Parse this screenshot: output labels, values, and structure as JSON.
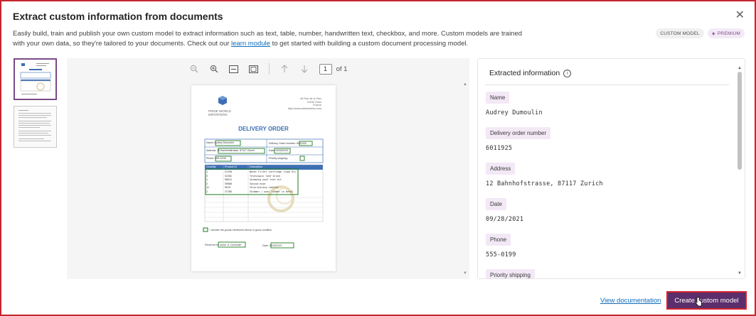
{
  "dialog": {
    "title": "Extract custom information from documents",
    "description_before": "Easily build, train and publish your own custom model to extract information such as text, table, number, handwritten text, checkbox, and more. Custom models are trained with your own data, so they're tailored to your documents. Check out our ",
    "link_text": "learn module",
    "description_after": " to get started with building a custom document processing model.",
    "close_icon": "close-icon"
  },
  "badges": {
    "custom_model": "CUSTOM MODEL",
    "premium": "PREMIUM"
  },
  "viewer": {
    "page_number": "1",
    "page_of": "of 1"
  },
  "document": {
    "company_line1": "PRIDE WORLD",
    "company_line2": "IMPORTERS",
    "address_line1": "46 Rue de la Paix",
    "address_line2": "10032 Paris",
    "address_line3": "France",
    "website": "http://www.webaddress.com",
    "title": "DELIVERY ORDER",
    "name_label": "Name:",
    "name_value": "Audrey Dumoulin",
    "order_label": "Delivery Order Number:",
    "order_value": "6011925",
    "address_label": "Address:",
    "address_value": "12 Bahnhofstrasse, 87117 Zurich",
    "date_label": "Date:",
    "date_value": "09/28/2021",
    "phone_label": "Phone:",
    "phone_value": "555-0199",
    "priority_label": "Priority shipping:",
    "col_quantity": "Quantity",
    "col_product": "Product ID",
    "col_description": "Description",
    "rows": [
      [
        "1",
        "51290",
        "Water Filter cartridge (type 01)"
      ],
      [
        "3",
        "52302",
        "Telescopic leaf brush"
      ],
      [
        "1",
        "90012",
        "Swimming pool test kit"
      ],
      [
        "2",
        "59000",
        "Vacuum hose"
      ],
      [
        "12",
        "9019",
        "Chlorinating tablets"
      ],
      [
        "1",
        "37185",
        "Skimmer / pool ladder in metal"
      ]
    ],
    "received_note": "I declare the goods mentioned above in good condition",
    "received_label": "Received by name:",
    "received_value": "A. Dumoulin",
    "sign_date_label": "Date:",
    "sign_date_value": "09/28/2021"
  },
  "panel": {
    "title": "Extracted information",
    "fields": [
      {
        "label": "Name",
        "value": "Audrey Dumoulin"
      },
      {
        "label": "Delivery order number",
        "value": "6011925"
      },
      {
        "label": "Address",
        "value": "12 Bahnhofstrasse, 87117 Zurich"
      },
      {
        "label": "Date",
        "value": "09/28/2021"
      },
      {
        "label": "Phone",
        "value": "555-0199"
      },
      {
        "label": "Priority shipping",
        "value": ""
      }
    ]
  },
  "footer": {
    "view_docs": "View documentation",
    "create_model": "Create custom model"
  },
  "colors": {
    "accent": "#5c2e6b",
    "highlight_border": "#d4262e",
    "bbox": "#1e7a1e",
    "doc_blue": "#3d6fb5"
  }
}
